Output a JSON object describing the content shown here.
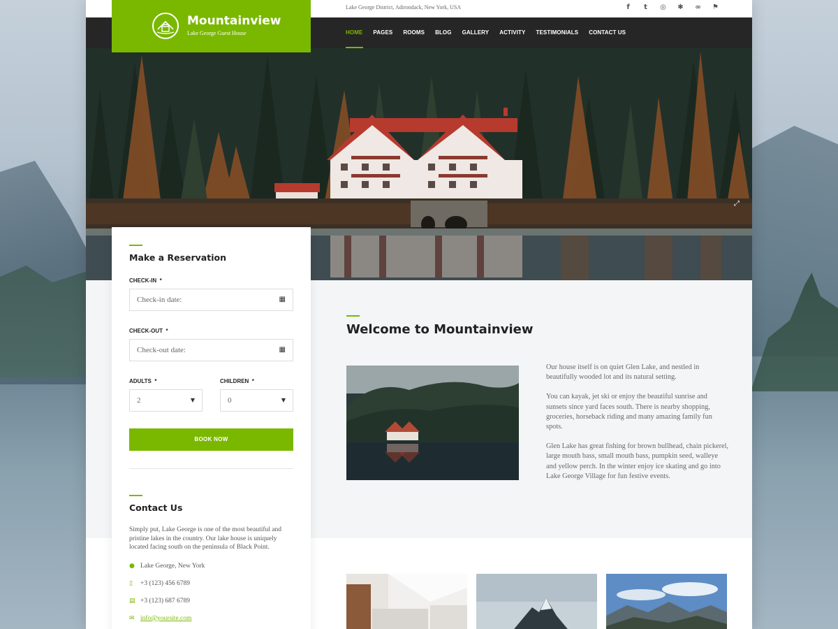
{
  "site": {
    "name": "Mountainview",
    "tagline": "Lake George Guest House",
    "address": "Lake George District, Adirondack, New York, USA"
  },
  "social_icons": [
    "facebook-icon",
    "twitter-icon",
    "instagram-icon",
    "yelp-icon",
    "tripadvisor-icon",
    "foursquare-icon"
  ],
  "social_glyphs": [
    "f",
    "t",
    "◎",
    "✱",
    "∞",
    "⚑"
  ],
  "nav": {
    "items": [
      "HOME",
      "PAGES",
      "ROOMS",
      "BLOG",
      "GALLERY",
      "ACTIVITY",
      "TESTIMONIALS",
      "CONTACT US"
    ],
    "active": "HOME"
  },
  "reservation": {
    "title": "Make a Reservation",
    "checkin_label": "CHECK-IN",
    "checkin_placeholder": "Check-in date:",
    "checkout_label": "CHECK-OUT",
    "checkout_placeholder": "Check-out date:",
    "required_mark": "*",
    "adults_label": "ADULTS",
    "adults_value": "2",
    "children_label": "CHILDREN",
    "children_value": "0",
    "book_label": "BOOK NOW"
  },
  "contact": {
    "title": "Contact Us",
    "text": "Simply put, Lake George is one of the most beautiful and pristine lakes in the country. Our lake house is uniquely located facing south on the peninsula of Black Point.",
    "location": "Lake George, New York",
    "phone": "+3 (123) 456 6789",
    "fax": "+3 (123) 687 6789",
    "email": "info@yoursite.com"
  },
  "welcome": {
    "title": "Welcome to Mountainview",
    "paragraphs": [
      "Our house itself is on quiet Glen Lake, and nestled in beautifully wooded lot and its natural setting.",
      "You can kayak, jet ski or enjoy the beautiful sunrise and sunsets since yard faces south. There is nearby shopping, groceries, horseback riding and many amazing family fun spots.",
      "Glen Lake has great fishing for brown bullhead, chain pickerel, large mouth bass, small mouth bass, pumpkin seed, walleye and yellow perch. In the winter enjoy ice skating and go into Lake George Village for fun festive events."
    ]
  },
  "colors": {
    "accent": "#7ab800",
    "nav_bg": "#262626",
    "section_bg": "#f4f5f7"
  }
}
